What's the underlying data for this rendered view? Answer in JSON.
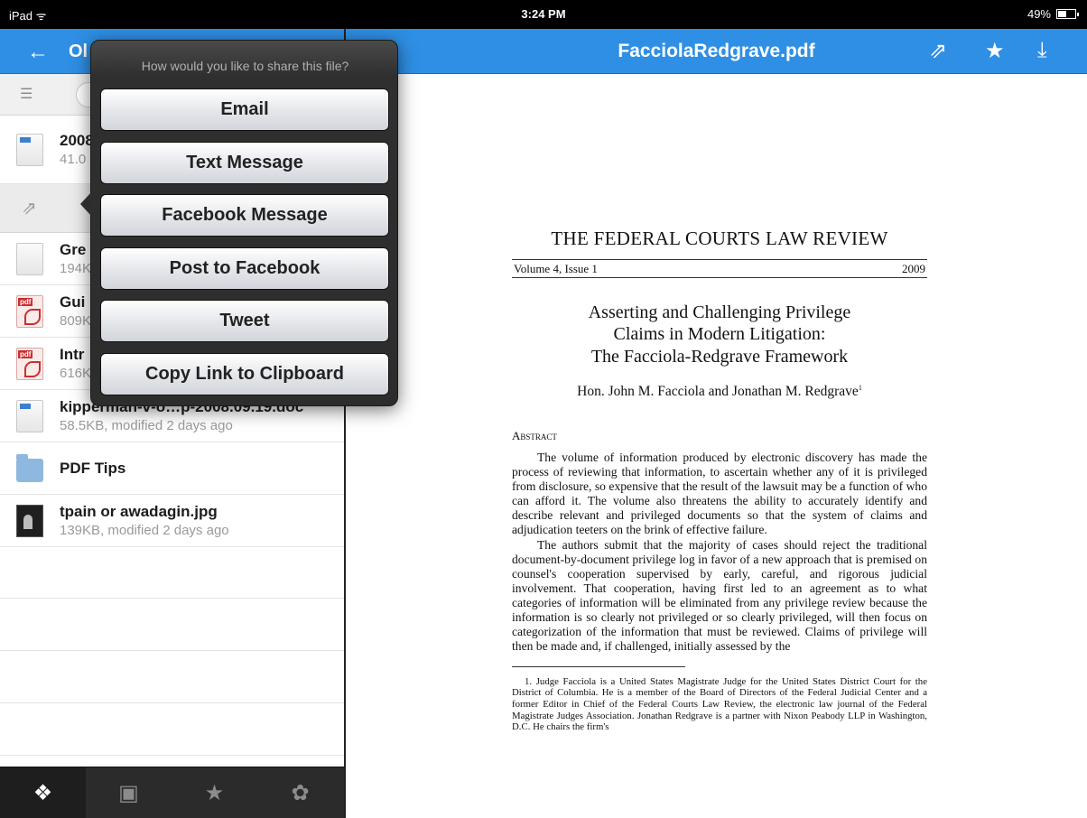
{
  "status_bar": {
    "carrier": "iPad ᯤ",
    "time": "3:24 PM",
    "battery": "49%",
    "battery_level": 0.49
  },
  "left_nav": {
    "back_icon": "←",
    "title": "Ol"
  },
  "files": [
    {
      "name": "2008",
      "meta": "41.0",
      "icon": "word-doc-icon"
    },
    {
      "name": "Gre",
      "meta": "194K",
      "icon": "doc-icon"
    },
    {
      "name": "Gui",
      "meta": "809K",
      "icon": "pdf-icon"
    },
    {
      "name": "Intr",
      "meta": "616K",
      "icon": "pdf-icon"
    },
    {
      "name": "kipperman-v-o…p-2008.09.19.doc",
      "meta": "58.5KB, modified 2 days ago",
      "icon": "word-doc-icon"
    },
    {
      "name": "PDF Tips",
      "meta": "",
      "icon": "folder-icon"
    },
    {
      "name": "tpain or awadagin.jpg",
      "meta": "139KB, modified 2 days ago",
      "icon": "photo-icon"
    }
  ],
  "tabs": [
    {
      "icon": "❖",
      "name": "dropbox-icon",
      "active": true
    },
    {
      "icon": "▣",
      "name": "photos-icon",
      "active": false
    },
    {
      "icon": "★",
      "name": "favorites-icon",
      "active": false
    },
    {
      "icon": "✿",
      "name": "settings-icon",
      "active": false
    }
  ],
  "right_nav": {
    "title": "FacciolaRedgrave.pdf",
    "share_icon": "⇗",
    "star_icon": "★",
    "download_icon": "⤓"
  },
  "share_popover": {
    "prompt": "How would you like to share this file?",
    "options": [
      "Email",
      "Text Message",
      "Facebook Message",
      "Post to Facebook",
      "Tweet",
      "Copy Link to Clipboard"
    ]
  },
  "document": {
    "journal": "THE FEDERAL COURTS LAW REVIEW",
    "volume": "Volume 4, Issue 1",
    "year": "2009",
    "title_lines": [
      "Asserting and Challenging Privilege",
      "Claims in Modern Litigation:",
      "The Facciola-Redgrave Framework"
    ],
    "authors": "Hon. John M. Facciola and Jonathan M. Redgrave",
    "footnote_mark": "1",
    "abstract_heading": "Abstract",
    "paragraphs": [
      "The volume of information produced by electronic discovery has made the process of reviewing that information, to ascertain whether any of it is privileged from disclosure, so expensive that the result of the lawsuit may be a function of who can afford it. The volume also threatens the ability to accurately identify and describe relevant and privileged documents so that the system of claims and adjudication teeters on the brink of effective failure.",
      "The authors submit that the majority of cases should reject the traditional document-by-document privilege log in favor of a new approach that is premised on counsel's cooperation supervised by early, careful, and rigorous judicial involvement. That cooperation, having first led to an agreement as to what categories of information will be eliminated from any privilege review because the information is so clearly not privileged or so clearly privileged, will then focus on categorization of the information that must be reviewed. Claims of privilege will then be made and, if challenged, initially assessed by the"
    ],
    "footnote": "1. Judge Facciola is a United States Magistrate Judge for the United States District Court for the District of Columbia. He is a member of the Board of Directors of the Federal Judicial Center and a former Editor in Chief of the Federal Courts Law Review, the electronic law journal of the Federal Magistrate Judges Association. Jonathan Redgrave is a partner with Nixon Peabody LLP in Washington, D.C. He chairs the firm's"
  }
}
